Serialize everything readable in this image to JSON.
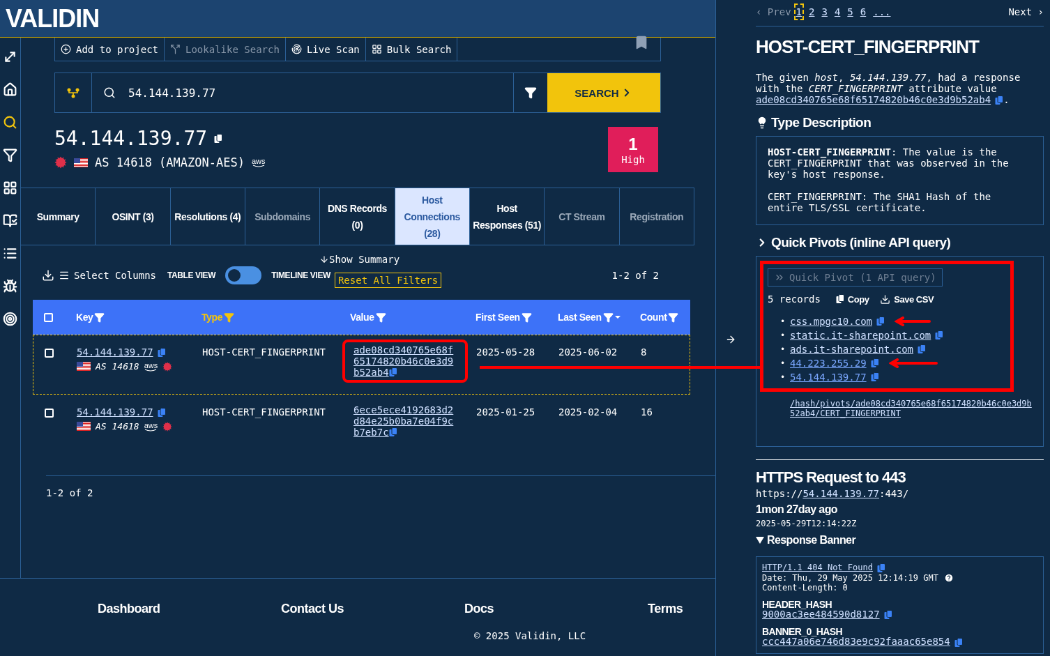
{
  "logo": "VALIDIN",
  "sidebar": {
    "items": [
      {
        "kind": "expand",
        "selected": false
      },
      {
        "kind": "home",
        "selected": false
      },
      {
        "kind": "search",
        "selected": true
      },
      {
        "kind": "filter",
        "selected": false
      },
      {
        "kind": "grid",
        "selected": false
      },
      {
        "kind": "compare",
        "selected": false
      },
      {
        "kind": "list",
        "selected": false
      },
      {
        "kind": "bug",
        "selected": false
      },
      {
        "kind": "target",
        "selected": false
      }
    ]
  },
  "toolbar": [
    {
      "kind": "add",
      "label": "Add to project",
      "disabled": false
    },
    {
      "kind": "lookalike",
      "label": "Lookalike Search",
      "disabled": true
    },
    {
      "kind": "scan",
      "label": "Live Scan",
      "disabled": false
    },
    {
      "kind": "grid",
      "label": "Bulk Search",
      "disabled": false
    }
  ],
  "search": {
    "value": "54.144.139.77",
    "button": "SEARCH"
  },
  "host": {
    "ip": "54.144.139.77",
    "asn": "AS 14618 (AMAZON-AES)",
    "provider": "aws"
  },
  "risk": {
    "count": "1",
    "level": "High"
  },
  "tabs": [
    {
      "label": "Summary",
      "selected": false,
      "disabled": false
    },
    {
      "label": "OSINT (3)",
      "selected": false,
      "disabled": false
    },
    {
      "label": "Resolutions (4)",
      "selected": false,
      "disabled": false
    },
    {
      "label": "Subdomains",
      "selected": false,
      "disabled": true
    },
    {
      "label": "DNS Records (0)",
      "selected": false,
      "disabled": false
    },
    {
      "label": "Host Connections (28)",
      "selected": true,
      "disabled": false
    },
    {
      "label": "Host Responses (51)",
      "selected": false,
      "disabled": false
    },
    {
      "label": "CT Stream",
      "selected": false,
      "disabled": true
    },
    {
      "label": "Registration",
      "selected": false,
      "disabled": true
    }
  ],
  "controls": {
    "select_columns": "Select Columns",
    "table_view": "TABLE VIEW",
    "toggle_on": false,
    "timeline_view": "TIMELINE VIEW",
    "show_summary": "Show Summary",
    "reset": "Reset All Filters",
    "range": "1-2 of 2"
  },
  "table": {
    "all_checked": false,
    "columns": [
      {
        "label": "Key",
        "active": false,
        "sorted": false
      },
      {
        "label": "Type",
        "active": true,
        "sorted": false
      },
      {
        "label": "Value",
        "active": false,
        "sorted": false
      },
      {
        "label": "First Seen",
        "active": false,
        "sorted": false
      },
      {
        "label": "Last Seen",
        "active": false,
        "sorted": true
      },
      {
        "label": "Count",
        "active": false,
        "sorted": false
      }
    ],
    "rows": [
      {
        "key": "54.144.139.77",
        "asn": "AS 14618",
        "provider": "aws",
        "type": "HOST-CERT_FINGERPRINT",
        "value": "ade08cd340765e68f65174820b46c0e3d9b52ab4",
        "first_seen": "2025-05-28",
        "last_seen": "2025-06-02",
        "count": "8",
        "checked": false,
        "selected": true,
        "annotated": true
      },
      {
        "key": "54.144.139.77",
        "asn": "AS 14618",
        "provider": "aws",
        "type": "HOST-CERT_FINGERPRINT",
        "value": "6ece5ece4192683d2d84e25b0ba7e04f9cb7eb7c",
        "first_seen": "2025-01-25",
        "last_seen": "2025-02-04",
        "count": "16",
        "checked": false,
        "selected": false,
        "annotated": false
      }
    ]
  },
  "range_bottom": "1-2 of 2",
  "footer": {
    "links": [
      "Dashboard",
      "Contact Us",
      "Docs",
      "Terms"
    ],
    "copyright": "© 2025 Validin, LLC"
  },
  "pager": {
    "prev": "‹ Prev",
    "pages": [
      {
        "label": "1",
        "selected": true
      },
      {
        "label": "2",
        "selected": false
      },
      {
        "label": "3",
        "selected": false
      },
      {
        "label": "4",
        "selected": false
      },
      {
        "label": "5",
        "selected": false
      },
      {
        "label": "6",
        "selected": false
      },
      {
        "label": "...",
        "selected": false
      }
    ],
    "next": "Next ›"
  },
  "detail": {
    "title": "HOST-CERT_FINGERPRINT",
    "summary": "The given *host*, *54.144.139.77*, had a response with the *CERT_FINGERPRINT* attribute value",
    "summary_link": "ade08cd340765e68f65174820b46c0e3d9b52ab4",
    "summary_end": ".",
    "type_heading": "Type Description",
    "type_paragraphs": [
      "**HOST-CERT_FINGERPRINT**: The value is the CERT_FINGERPRINT that was observed in the key's host response.",
      "CERT_FINGERPRINT: The SHA1 Hash of the entire TLS/SSL certificate."
    ],
    "quick_pivots": {
      "heading": "Quick Pivots (inline API query)",
      "button": "Quick Pivot (1 API query)",
      "records": "5 records",
      "copy": "Copy",
      "save": "Save CSV",
      "annotated": true,
      "items": [
        {
          "marker": "•",
          "text": "css.mpgc10.com",
          "annotated": true,
          "visited": false
        },
        {
          "marker": "•",
          "text": "static.it-sharepoint.com",
          "annotated": false,
          "visited": false
        },
        {
          "marker": "•",
          "text": "ads.it-sharepoint.com",
          "annotated": false,
          "visited": false
        },
        {
          "marker": "•",
          "text": "44.223.255.29",
          "annotated": true,
          "visited": true
        },
        {
          "marker": "•",
          "text": "54.144.139.77",
          "annotated": false,
          "visited": true
        }
      ],
      "path": "/hash/pivots/ade08cd340765e68f65174820b46c0e3d9b52ab4/CERT_FINGERPRINT"
    }
  },
  "https": {
    "title": "HTTPS Request to 443",
    "url_prefix": "https://",
    "url_link": "54.144.139.77",
    "url_suffix": ":443/",
    "age": "1mon 27day ago",
    "timestamp": "2025-05-29T12:14:22Z",
    "banner_heading": "Response Banner",
    "status_line": "HTTP/1.1 404 Not Found",
    "date_line": "Date: Thu, 29 May 2025 12:14:19 GMT",
    "length_line": "Content-Length: 0",
    "header_hash_label": "HEADER_HASH",
    "header_hash": "9000ac3ee484590d8127",
    "banner_hash_label": "BANNER_0_HASH",
    "banner_hash": "ccc447a06e746d83e9c92faaac65e854"
  }
}
